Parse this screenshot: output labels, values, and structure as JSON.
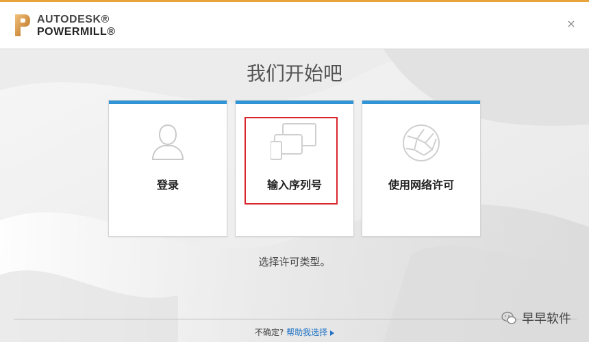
{
  "brand": {
    "line1": "AUTODESK®",
    "line2": "POWERMILL®"
  },
  "window": {
    "close_glyph": "×"
  },
  "page": {
    "title": "我们开始吧",
    "subtitle": "选择许可类型。"
  },
  "options": [
    {
      "label": "登录",
      "icon": "user-silhouette-icon"
    },
    {
      "label": "输入序列号",
      "icon": "devices-icon"
    },
    {
      "label": "使用网络许可",
      "icon": "network-globe-icon"
    }
  ],
  "help": {
    "question": "不确定?",
    "link_label": "帮助我选择"
  },
  "watermark": {
    "text": "早早软件"
  },
  "colors": {
    "accent_bar": "#2f95d6",
    "top_accent": "#e8a33d",
    "highlight": "#d9262c",
    "link": "#1f72c4"
  }
}
